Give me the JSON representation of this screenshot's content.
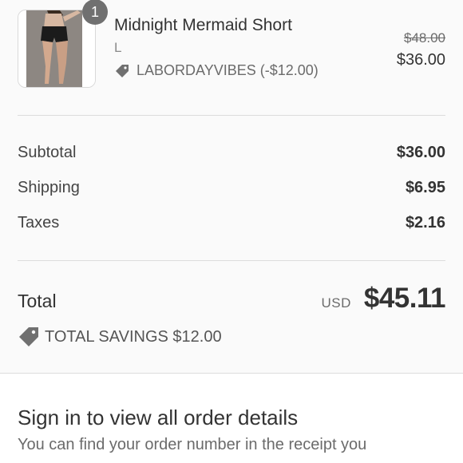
{
  "line_item": {
    "quantity": "1",
    "name": "Midnight Mermaid Short",
    "variant": "L",
    "discount": "LABORDAYVIBES (-$12.00)",
    "original_price": "$48.00",
    "price": "$36.00",
    "thumbnail_icon": "product-photo"
  },
  "costs": [
    {
      "label": "Subtotal",
      "value": "$36.00"
    },
    {
      "label": "Shipping",
      "value": "$6.95"
    },
    {
      "label": "Taxes",
      "value": "$2.16"
    }
  ],
  "total": {
    "label": "Total",
    "currency": "USD",
    "amount": "$45.11"
  },
  "savings": {
    "text": "TOTAL SAVINGS $12.00"
  },
  "sign_in": {
    "title": "Sign in to view all order details",
    "text": "You can find your order number in the receipt you"
  },
  "colors": {
    "background": "#fafafa",
    "badge": "#707070",
    "tag_icon": "#707070"
  }
}
